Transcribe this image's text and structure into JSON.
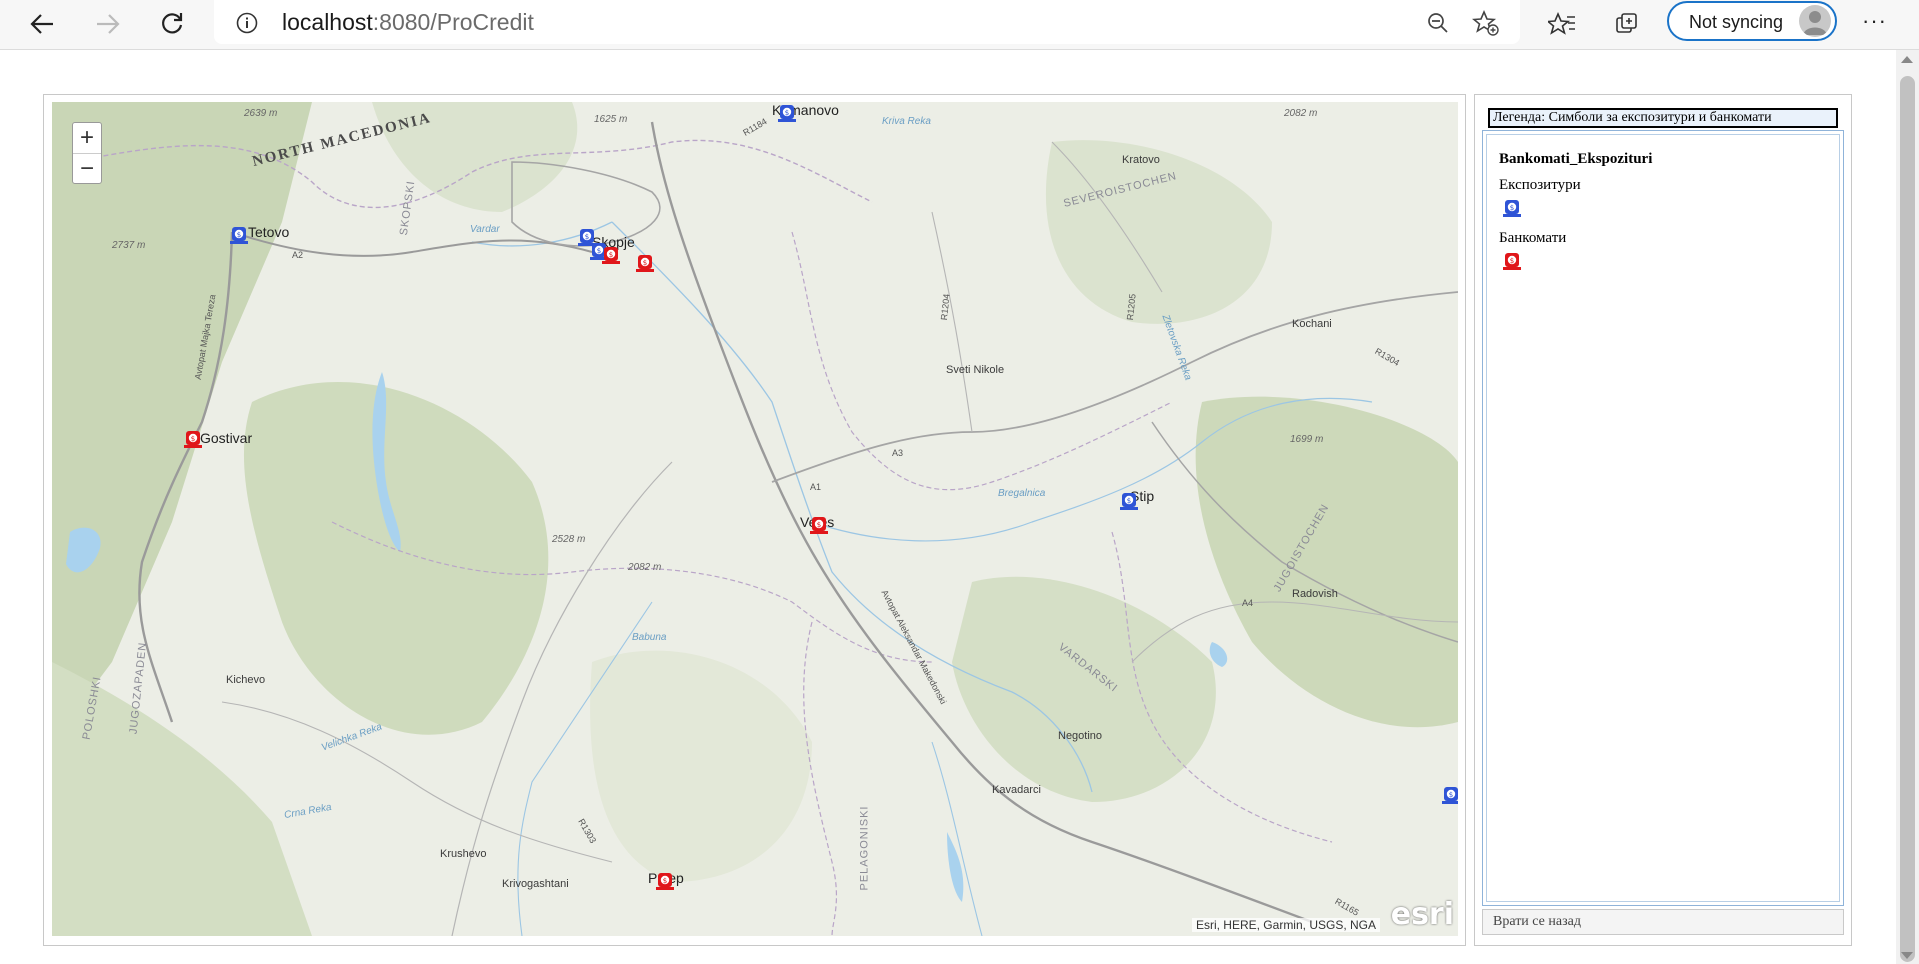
{
  "browser": {
    "url_host": "localhost",
    "url_rest": ":8080/ProCredit",
    "sync_label": "Not syncing",
    "more_label": "···"
  },
  "map": {
    "zoom_in": "+",
    "zoom_out": "−",
    "attribution": "Esri, HERE, Garmin, USGS, NGA",
    "logo": "esri",
    "country_label": "NORTH MACEDONIA",
    "places": {
      "skopje": "Skopje",
      "tetovo": "Tetovo",
      "gostivar": "Gostivar",
      "kumanovo": "Kumanovo",
      "veles": "Veles",
      "stip": "Stip",
      "prilep": "Prilep",
      "kichevo": "Kichevo",
      "krushevo": "Krushevo",
      "krivogashtani": "Krivogashtani",
      "kavadarci": "Kavadarci",
      "negotino": "Negotino",
      "radovish": "Radovish",
      "kochani": "Kochani",
      "kratovo": "Kratovo",
      "sveti_nikole": "Sveti Nikole"
    },
    "regions": {
      "severoistochen": "SEVEROISTOCHEN",
      "skopski": "SKOPSKI",
      "jugoistochen": "JUGOISTOCHEN",
      "vardarski": "VARDARSKI",
      "pelagoniski": "PELAGONISKI",
      "poloshki": "POLOSHKI",
      "jugozapaden": "JUGOZAPADEN"
    },
    "roads": {
      "avtopat_tereza": "Avtopat Majka Tereza",
      "avtopat_makedonski": "Avtopat Aleksandar Makedonski",
      "a1": "A1",
      "a2": "A2",
      "a3": "A3",
      "a4": "A4",
      "r1204": "R1204",
      "r1205": "R1205",
      "r1184": "R1184",
      "r1303": "R1303",
      "r1304": "R1304",
      "r1165": "R1165"
    },
    "elevations": {
      "e2639": "2639 m",
      "e1625": "1625 m",
      "e2737": "2737 m",
      "e2528": "2528 m",
      "e2082a": "2082 m",
      "e2082b": "2082 m",
      "e1699": "1699 m"
    },
    "rivers": {
      "vardar": "Vardar",
      "kriva_reka": "Kriva Reka",
      "bregalnica": "Bregalnica",
      "babuna": "Babuna",
      "velichka": "Velichka Reka",
      "crna": "Crna Reka",
      "zletovska": "Zletovska Reka"
    }
  },
  "legend": {
    "title": "Легенда: Симболи за експозитури и банкомати",
    "layer_name": "Bankomati_Ekspozituri",
    "branches_label": "Експозитури",
    "atms_label": "Банкомати",
    "back_button": "Врати се назад"
  },
  "colors": {
    "branch_marker": "#2f54d6",
    "atm_marker": "#e0161a",
    "accent": "#1a73c8"
  }
}
